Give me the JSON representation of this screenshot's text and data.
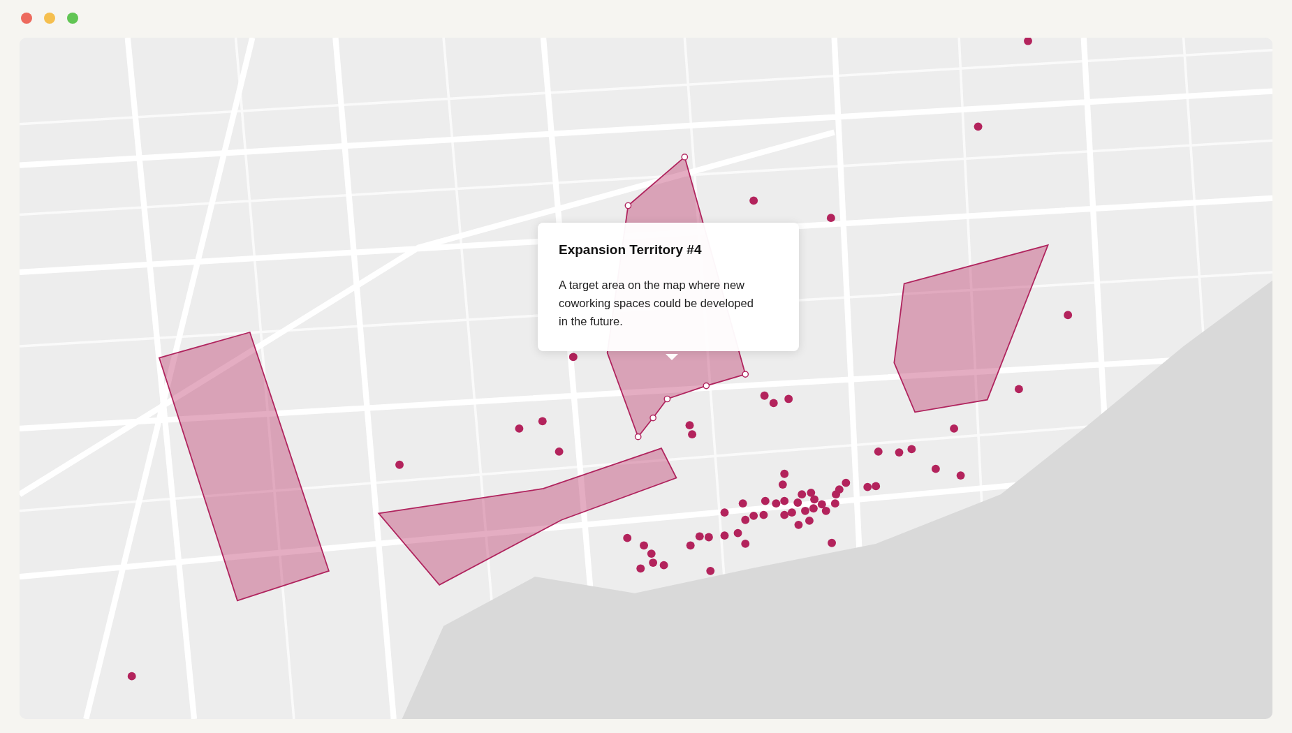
{
  "window": {
    "controls": [
      {
        "color": "#ed6a5e"
      },
      {
        "color": "#f5bf4f"
      },
      {
        "color": "#61c554"
      }
    ]
  },
  "tooltip": {
    "title": "Expansion Territory #4",
    "text": "A target area on the map where new coworking spaces could be developed in the future."
  }
}
